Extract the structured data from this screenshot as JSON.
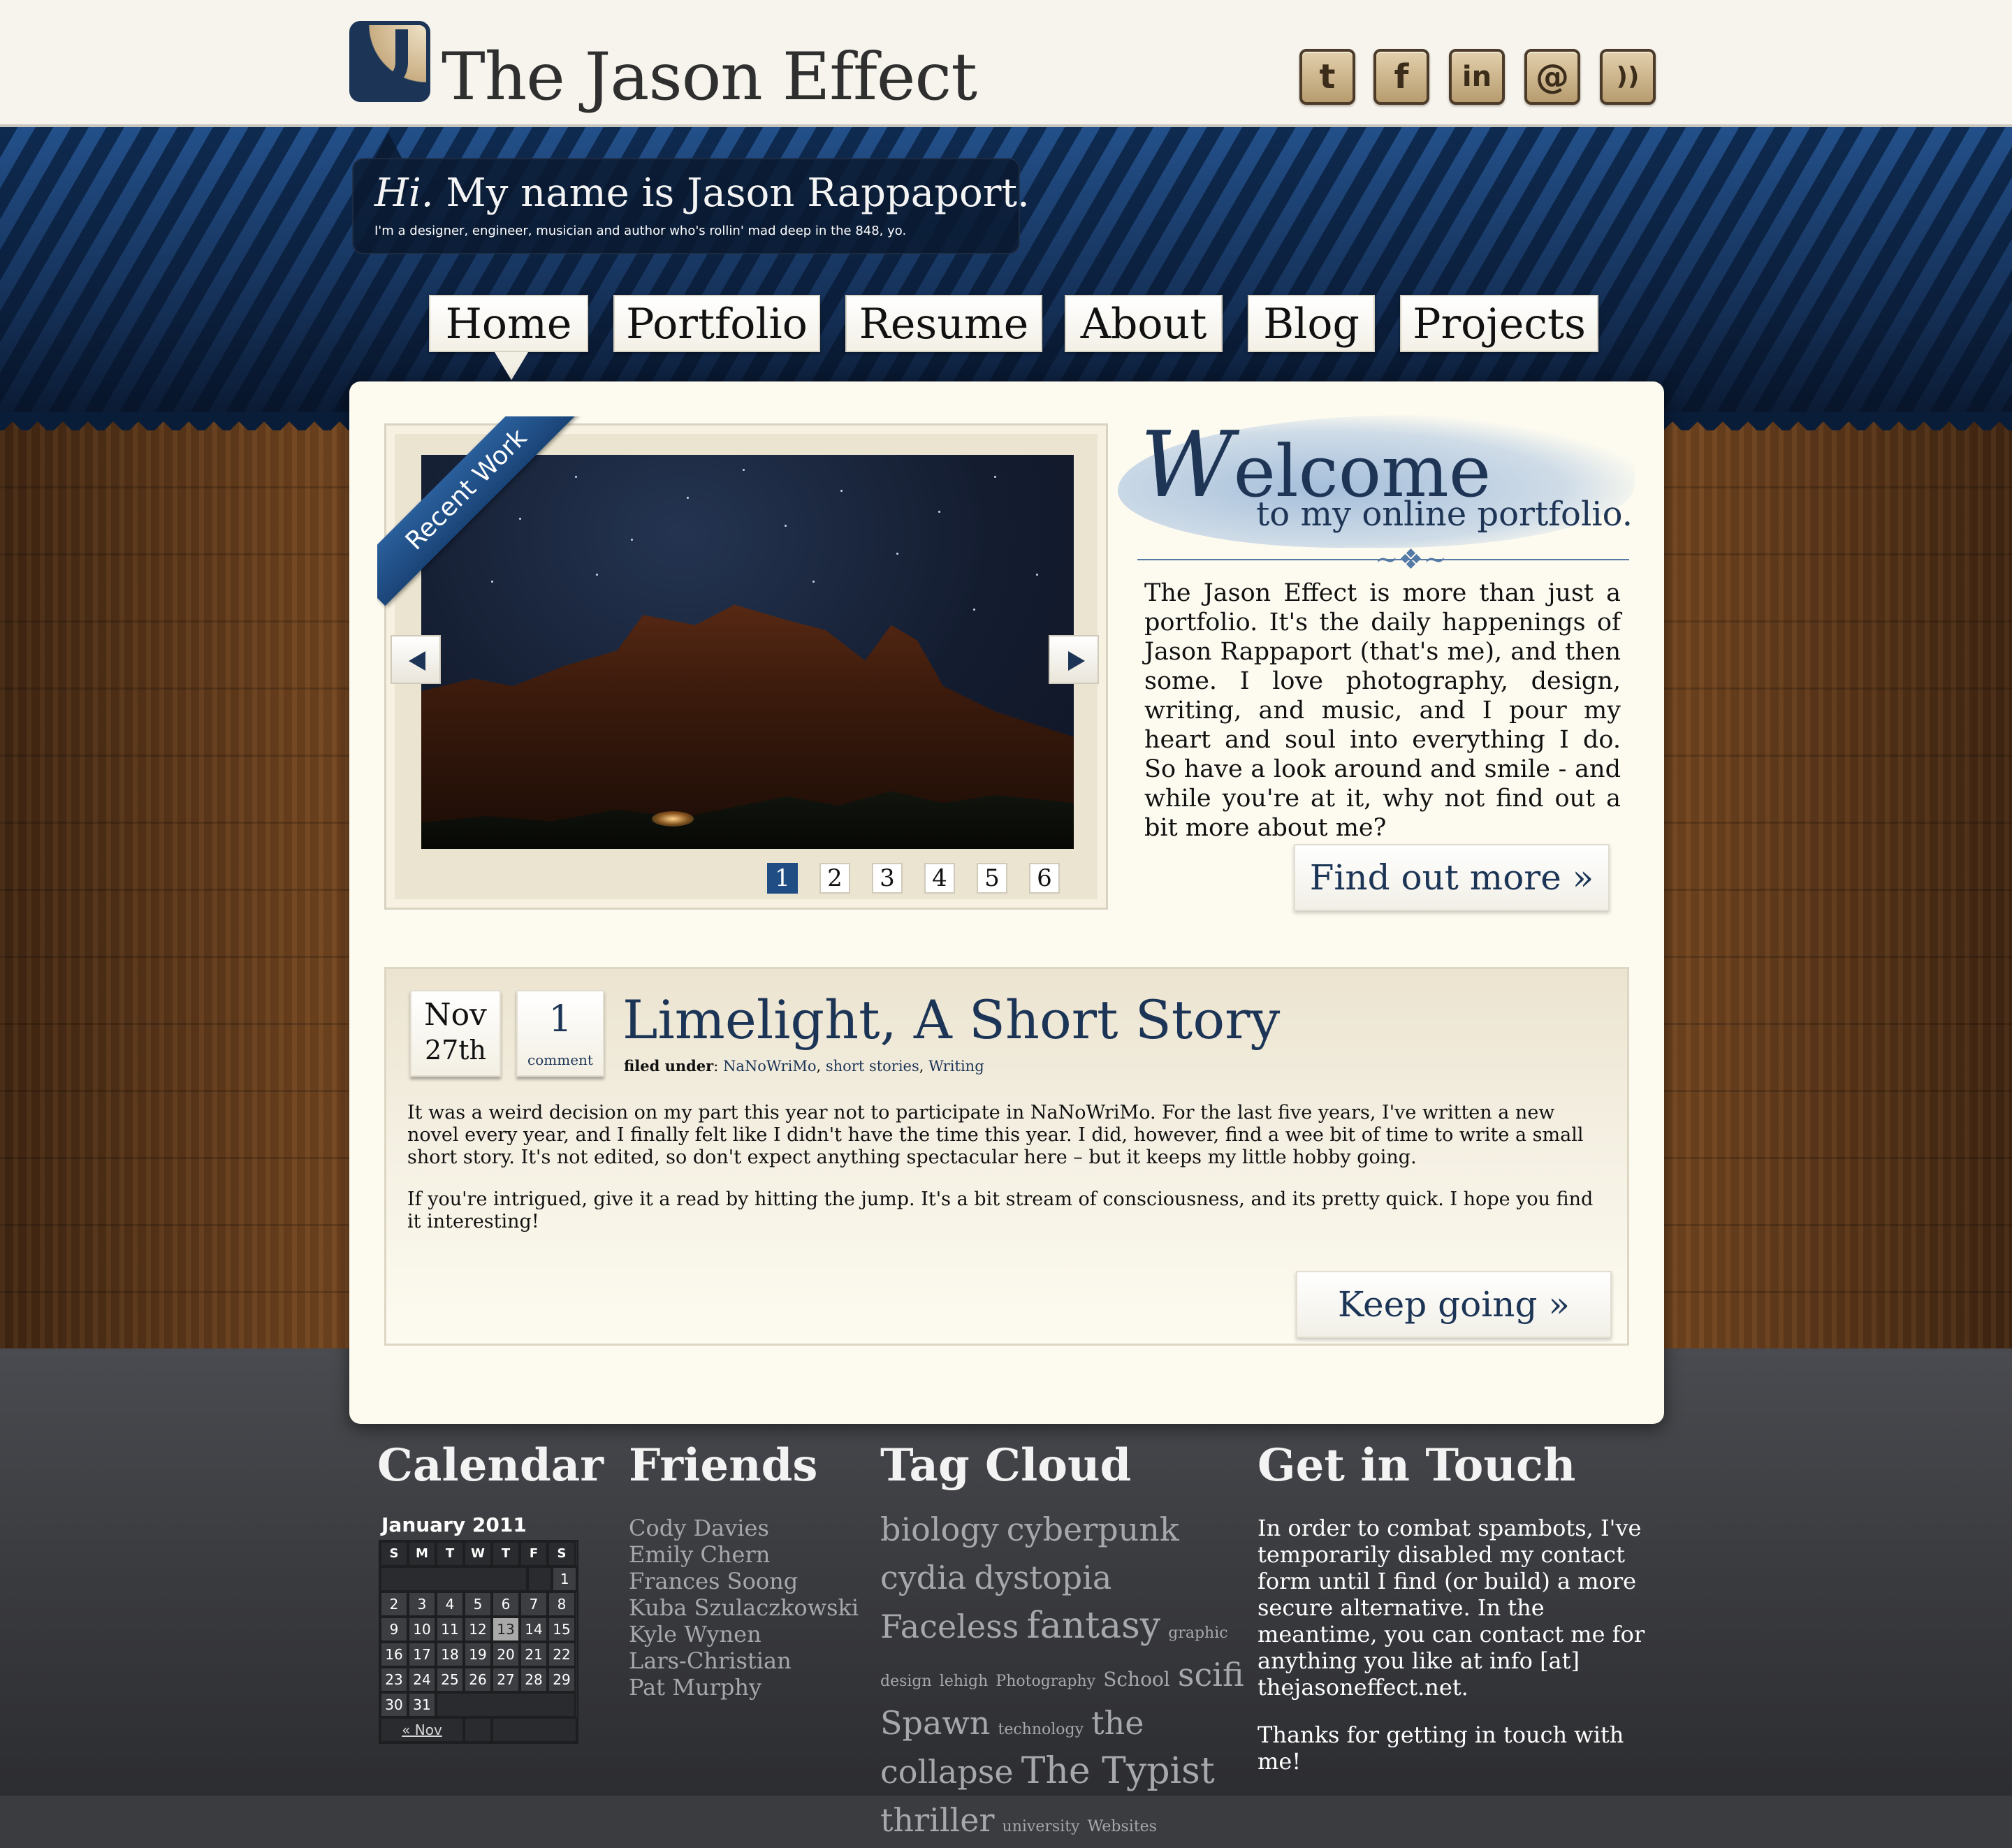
{
  "header": {
    "site_title": "The Jason Effect",
    "social": [
      {
        "icon": "twitter-icon",
        "glyph": "t"
      },
      {
        "icon": "facebook-icon",
        "glyph": "f"
      },
      {
        "icon": "linkedin-icon",
        "glyph": "in"
      },
      {
        "icon": "email-icon",
        "glyph": "@"
      },
      {
        "icon": "rss-icon",
        "glyph": "))"
      }
    ]
  },
  "greeting": {
    "hi": "Hi.",
    "title": " My name is Jason Rappaport.",
    "subtitle": "I'm a designer, engineer, musician and author who's rollin' mad deep in the 848, yo."
  },
  "nav": {
    "items": [
      "Home",
      "Portfolio",
      "Resume",
      "About",
      "Blog",
      "Projects"
    ],
    "active": "Home"
  },
  "slider": {
    "ribbon": "Recent Work",
    "pages": [
      "1",
      "2",
      "3",
      "4",
      "5",
      "6"
    ],
    "active_page": "1"
  },
  "welcome": {
    "title_w": "W",
    "title_rest": "elcome",
    "subtitle": "to my online portfolio.",
    "body": "The Jason Effect is more than just a portfolio. It's the daily happenings of Jason Rappaport (that's me), and then some. I love photography, design, writing, and music, and I pour my heart and soul into everything I do. So have a look around and smile - and while you're at it, why not find out a bit more about me?",
    "button": "Find out more »"
  },
  "post": {
    "month": "Nov",
    "day": "27th",
    "comment_count": "1",
    "comment_label": "comment",
    "title": "Limelight, A Short Story",
    "filed_label": "filed under",
    "tags": [
      "NaNoWriMo",
      "short stories",
      "Writing"
    ],
    "paragraphs": [
      "It was a weird decision on my part this year not to participate in NaNoWriMo. For the last five years, I've written a new novel every year, and I finally felt like I didn't have the time this year. I did, however, find a wee bit of time to write a small short story. It's not edited, so don't expect anything spectacular here – but it keeps my little hobby going.",
      "If you're intrigued, give it a read by hitting the jump. It's a bit stream of consciousness, and its pretty quick. I hope you find it interesting!"
    ],
    "button": "Keep going »"
  },
  "footer": {
    "calendar": {
      "heading": "Calendar",
      "month": "January 2011",
      "weekdays": [
        "S",
        "M",
        "T",
        "W",
        "T",
        "F",
        "S"
      ],
      "weeks": [
        [
          "",
          "",
          "",
          "",
          "",
          "",
          "1"
        ],
        [
          "2",
          "3",
          "4",
          "5",
          "6",
          "7",
          "8"
        ],
        [
          "9",
          "10",
          "11",
          "12",
          "13",
          "14",
          "15"
        ],
        [
          "16",
          "17",
          "18",
          "19",
          "20",
          "21",
          "22"
        ],
        [
          "23",
          "24",
          "25",
          "26",
          "27",
          "28",
          "29"
        ],
        [
          "30",
          "31",
          "",
          "",
          "",
          "",
          ""
        ]
      ],
      "today": "13",
      "prev_link": "« Nov"
    },
    "friends": {
      "heading": "Friends",
      "items": [
        "Cody Davies",
        "Emily Chern",
        "Frances Soong",
        "Kuba Szulaczkowski",
        "Kyle Wynen",
        "Lars-Christian",
        "Pat Murphy"
      ]
    },
    "tag_cloud": {
      "heading": "Tag Cloud",
      "tags": [
        {
          "text": "biology",
          "size": 46
        },
        {
          "text": "cyberpunk",
          "size": 46
        },
        {
          "text": "cydia",
          "size": 46
        },
        {
          "text": "dystopia",
          "size": 46
        },
        {
          "text": "Faceless",
          "size": 46
        },
        {
          "text": "fantasy",
          "size": 52
        },
        {
          "text": "graphic design",
          "size": 22
        },
        {
          "text": "lehigh",
          "size": 22
        },
        {
          "text": "Photography",
          "size": 22
        },
        {
          "text": "School",
          "size": 28
        },
        {
          "text": "scifi",
          "size": 46
        },
        {
          "text": "Spawn",
          "size": 46
        },
        {
          "text": "technology",
          "size": 22
        },
        {
          "text": "the",
          "size": 46
        },
        {
          "text": "collapse",
          "size": 46
        },
        {
          "text": "The Typist",
          "size": 52
        },
        {
          "text": "thriller",
          "size": 46
        },
        {
          "text": "university",
          "size": 22
        },
        {
          "text": "Websites",
          "size": 22
        }
      ]
    },
    "contact": {
      "heading": "Get in Touch",
      "p1": "In order to combat spambots, I've temporarily disabled my contact form until I find (or build) a more secure alternative. In the meantime, you can contact me for anything you like at info [at] thejasoneffect.net.",
      "p2": "Thanks for getting in touch with me!"
    }
  },
  "colors": {
    "brand_navy": "#1c3556",
    "panel": "#fdfbf0",
    "active_pager": "#1f4d84"
  }
}
